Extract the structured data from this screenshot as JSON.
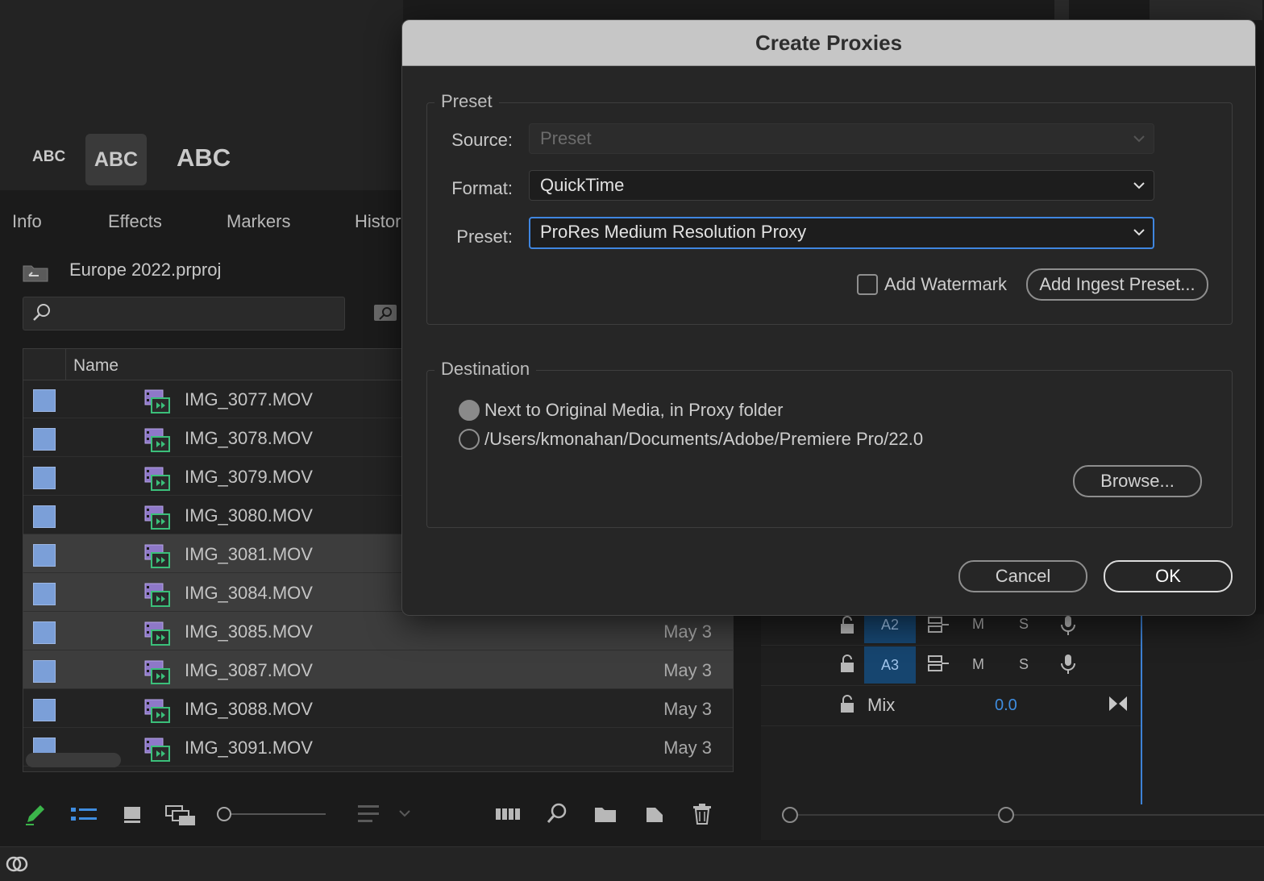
{
  "titles_panel": {
    "abc_small": "ABC",
    "abc_medium": "ABC",
    "abc_large": "ABC"
  },
  "tabs": {
    "info": "Info",
    "effects": "Effects",
    "markers": "Markers",
    "history": "Histor"
  },
  "project": {
    "title": "Europe 2022.prproj",
    "search_placeholder": "",
    "column_name": "Name",
    "swatch_color": "#7b9fd8",
    "rows": [
      {
        "name": "IMG_3077.MOV",
        "date": ""
      },
      {
        "name": "IMG_3078.MOV",
        "date": ""
      },
      {
        "name": "IMG_3079.MOV",
        "date": ""
      },
      {
        "name": "IMG_3080.MOV",
        "date": ""
      },
      {
        "name": "IMG_3081.MOV",
        "date": ""
      },
      {
        "name": "IMG_3084.MOV",
        "date": ""
      },
      {
        "name": "IMG_3085.MOV",
        "date": "May 3"
      },
      {
        "name": "IMG_3087.MOV",
        "date": "May 3"
      },
      {
        "name": "IMG_3088.MOV",
        "date": "May 3"
      },
      {
        "name": "IMG_3091.MOV",
        "date": "May 3"
      }
    ]
  },
  "timeline": {
    "tracks": [
      {
        "name": "A2",
        "m": "M",
        "s": "S"
      },
      {
        "name": "A3",
        "m": "M",
        "s": "S"
      }
    ],
    "mix_label": "Mix",
    "mix_value": "0.0",
    "accent": "#3d82d6"
  },
  "dialog": {
    "title": "Create Proxies",
    "preset_group": "Preset",
    "source_label": "Source:",
    "source_value": "Preset",
    "format_label": "Format:",
    "format_value": "QuickTime",
    "preset_label": "Preset:",
    "preset_value": "ProRes Medium Resolution Proxy",
    "add_watermark": "Add Watermark",
    "add_ingest_preset": "Add Ingest Preset...",
    "destination_group": "Destination",
    "dest_option_1": "Next to Original Media, in Proxy folder",
    "dest_option_2": "/Users/kmonahan/Documents/Adobe/Premiere Pro/22.0",
    "browse": "Browse...",
    "cancel": "Cancel",
    "ok": "OK"
  }
}
